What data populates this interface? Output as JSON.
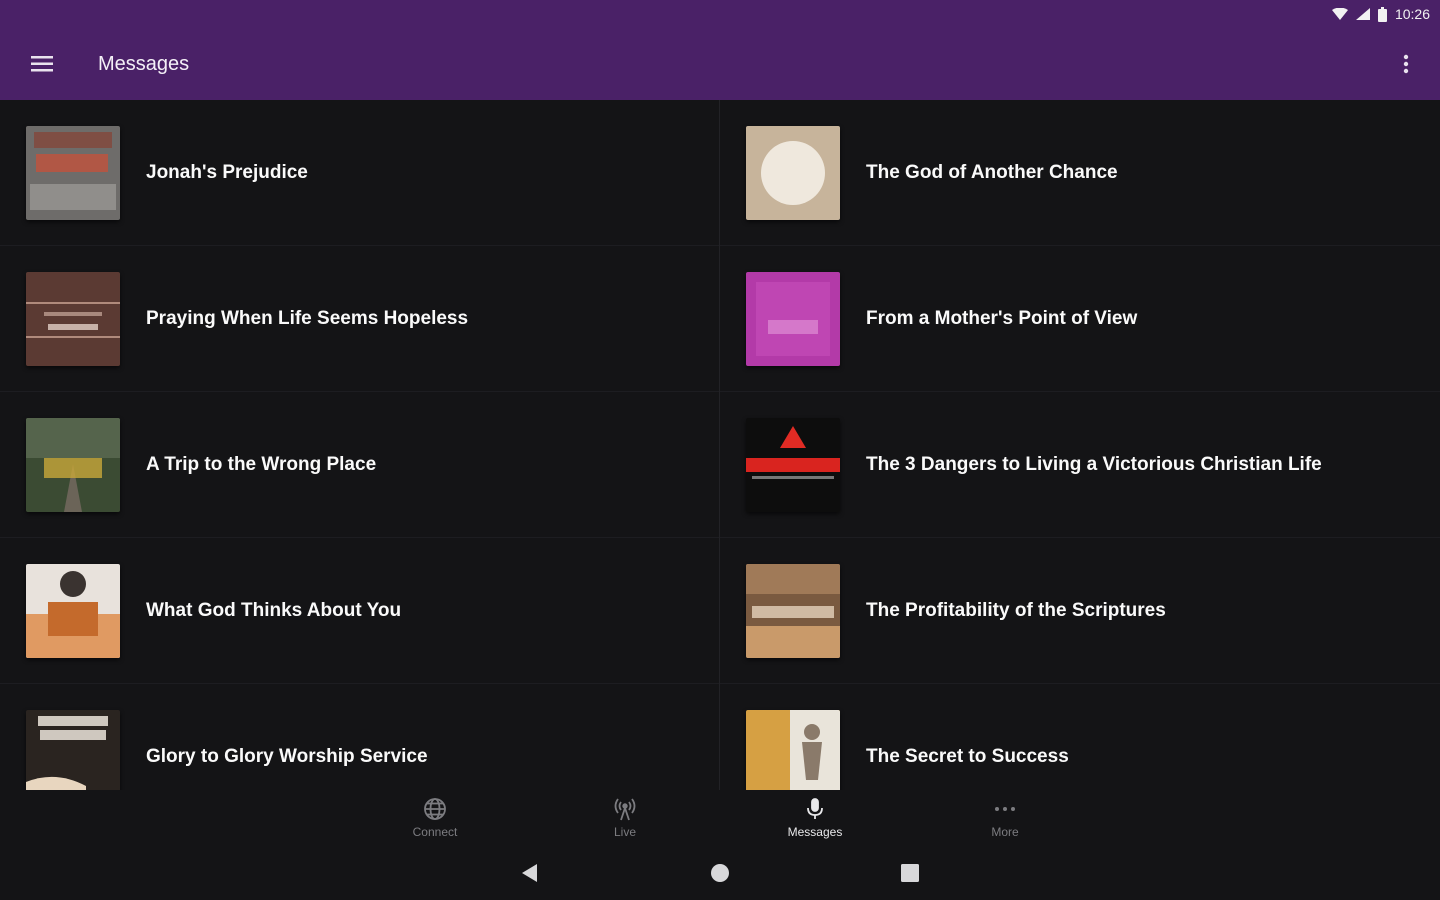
{
  "status_bar": {
    "time": "10:26",
    "icons": [
      "wifi-icon",
      "signal-icon",
      "battery-icon"
    ]
  },
  "app_bar": {
    "title": "Messages",
    "menu_icon": "hamburger-icon",
    "overflow_icon": "more-vert-icon",
    "color": "#4a2167"
  },
  "messages": {
    "left": [
      {
        "title": "Jonah's Prejudice"
      },
      {
        "title": "Praying When Life Seems Hopeless"
      },
      {
        "title": "A Trip to the Wrong Place"
      },
      {
        "title": "What God Thinks About You"
      },
      {
        "title": "Glory to Glory Worship Service"
      }
    ],
    "right": [
      {
        "title": "The God of Another Chance"
      },
      {
        "title": "From a Mother's Point of View"
      },
      {
        "title": "The 3 Dangers to Living a Victorious Christian Life"
      },
      {
        "title": "The Profitability of the Scriptures"
      },
      {
        "title": "The Secret to Success"
      }
    ]
  },
  "bottom_nav": {
    "items": [
      {
        "label": "Connect",
        "icon": "globe-icon"
      },
      {
        "label": "Live",
        "icon": "broadcast-icon"
      },
      {
        "label": "Messages",
        "icon": "microphone-icon",
        "active": true
      },
      {
        "label": "More",
        "icon": "more-horiz-icon"
      }
    ]
  },
  "system_nav": {
    "icons": [
      "back-icon",
      "home-icon",
      "recents-icon"
    ]
  }
}
